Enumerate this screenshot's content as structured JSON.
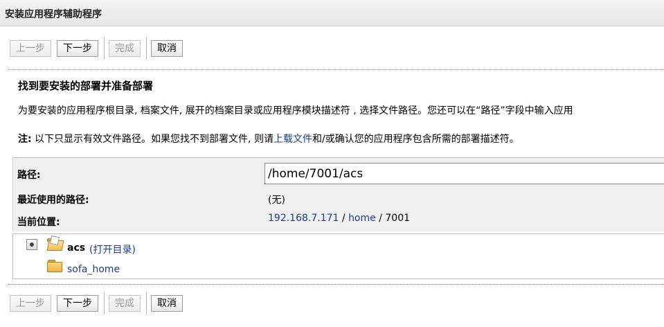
{
  "window": {
    "title": "安装应用程序辅助程序"
  },
  "buttons": {
    "back": "上一步",
    "next": "下一步",
    "finish": "完成",
    "cancel": "取消"
  },
  "section": {
    "heading": "找到要安装的部署并准备部署",
    "description": "为要安装的应用程序根目录, 档案文件, 展开的档案目录或应用程序模块描述符 , 选择文件路径。您还可以在“路径”字段中输入应用",
    "note_label": "注:",
    "note_before": " 以下只显示有效文件路径。如果您找不到部署文件, 则请",
    "note_link": "上载文件",
    "note_after": "和/或确认您的应用程序包含所需的部署描述符。"
  },
  "form": {
    "path_label": "路径:",
    "path_value": "/home/7001/acs",
    "recent_label": "最近使用的路径:",
    "recent_value": "(无)",
    "location_label": "当前位置:",
    "location": {
      "host": "192.168.7.171",
      "sep1": " / ",
      "dir1": "home",
      "sep2": " / ",
      "dir2": "7001"
    }
  },
  "files": [
    {
      "name": "acs",
      "action": "(打开目录)",
      "icon": "folder-open-icon",
      "selected": true
    },
    {
      "name": "sofa_home",
      "icon": "folder-icon",
      "selected": false
    }
  ]
}
